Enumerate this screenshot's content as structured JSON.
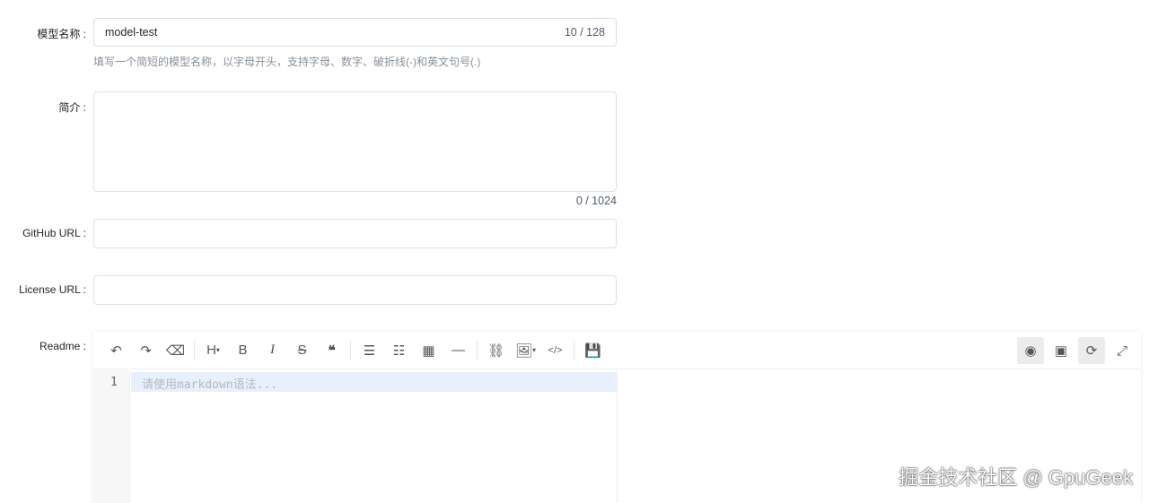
{
  "form": {
    "name": {
      "label": "模型名称 :",
      "value": "model-test",
      "count": "10 / 128",
      "help": "填写一个简短的模型名称，以字母开头，支持字母、数字、破折线(-)和英文句号(.)"
    },
    "intro": {
      "label": "简介 :",
      "value": "",
      "count": "0 / 1024"
    },
    "github": {
      "label": "GitHub URL :",
      "value": ""
    },
    "license": {
      "label": "License URL :",
      "value": ""
    },
    "readme": {
      "label": "Readme :",
      "line_number": "1",
      "placeholder": "请使用markdown语法..."
    }
  },
  "toolbar": {
    "heading": "H",
    "bold": "B",
    "italic": "I",
    "strike": "S",
    "quote": "❝",
    "code": "</>"
  },
  "watermark": "掘金技术社区 @ GpuGeek"
}
